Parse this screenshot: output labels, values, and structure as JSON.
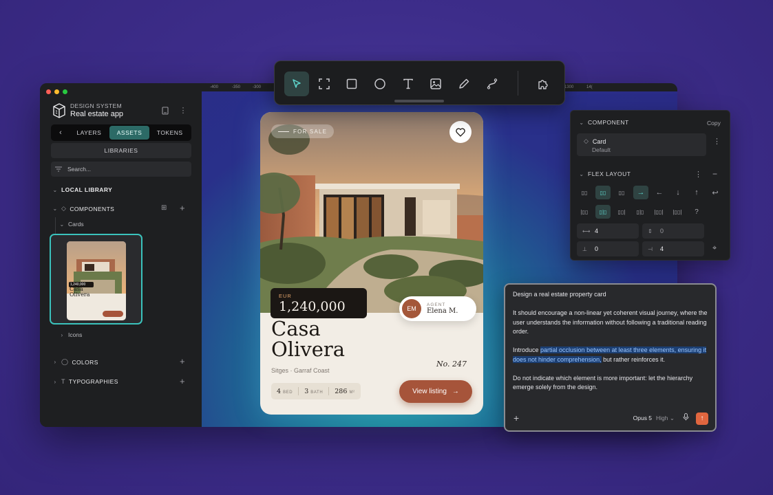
{
  "brand": {
    "subtitle": "DESIGN SYSTEM",
    "title": "Real estate app"
  },
  "tabs": {
    "back": "‹",
    "items": [
      "LAYERS",
      "ASSETS",
      "TOKENS"
    ],
    "active": "ASSETS"
  },
  "libraries_label": "LIBRARIES",
  "search": {
    "placeholder": "Search..."
  },
  "sidebar": {
    "local_library": "LOCAL LIBRARY",
    "components": "COMPONENTS",
    "cards_folder": "Cards",
    "icons_folder": "Icons",
    "colors": "COLORS",
    "typographies": "TYPOGRAPHIES",
    "thumb": {
      "title_line1": "Casa",
      "title_line2": "Olivera",
      "price": "1,240,000"
    }
  },
  "ruler": {
    "ticks": [
      "-400",
      "-350",
      "-300",
      "1300",
      "14("
    ]
  },
  "toolbar": {
    "tools": [
      "select-icon",
      "frame-icon",
      "rectangle-icon",
      "ellipse-icon",
      "text-icon",
      "image-icon",
      "pen-icon",
      "path-icon"
    ],
    "plugin": "puzzle-icon",
    "active": "select-icon"
  },
  "card": {
    "badge": "FOR SALE",
    "currency": "EUR",
    "price": "1,240,000",
    "agent_role": "AGENT",
    "agent_initials": "EM",
    "agent_name": "Elena M.",
    "title_line1": "Casa",
    "title_line2": "Olivera",
    "number": "No. 247",
    "location": "Sitges · Garraf Coast",
    "beds": "4",
    "beds_label": "BED",
    "baths": "3",
    "baths_label": "BATH",
    "area": "286",
    "area_label": "M²",
    "cta": "View listing",
    "accent": "#a6543a"
  },
  "rpanel": {
    "component_header": "COMPONENT",
    "copy": "Copy",
    "component_name": "Card",
    "component_variant": "Default",
    "flex_header": "FLEX LAYOUT",
    "gap_x": "4",
    "gap_y": "0",
    "padding_y": "0",
    "padding_x": "4"
  },
  "prompt": {
    "line1": "Design a real estate property card",
    "para2": "It should encourage a non-linear yet coherent visual journey, where the user understands the information without following a traditional reading order.",
    "para3_pre": "Introduce ",
    "para3_hl": "partial occlusion between at least three elements, ensuring it does not hinder comprehension,",
    "para3_post": " but rather reinforces it.",
    "para4": "Do not indicate which element is more important: let the hierarchy emerge solely from the design.",
    "model": "Opus 5",
    "effort": "High ⌄"
  }
}
